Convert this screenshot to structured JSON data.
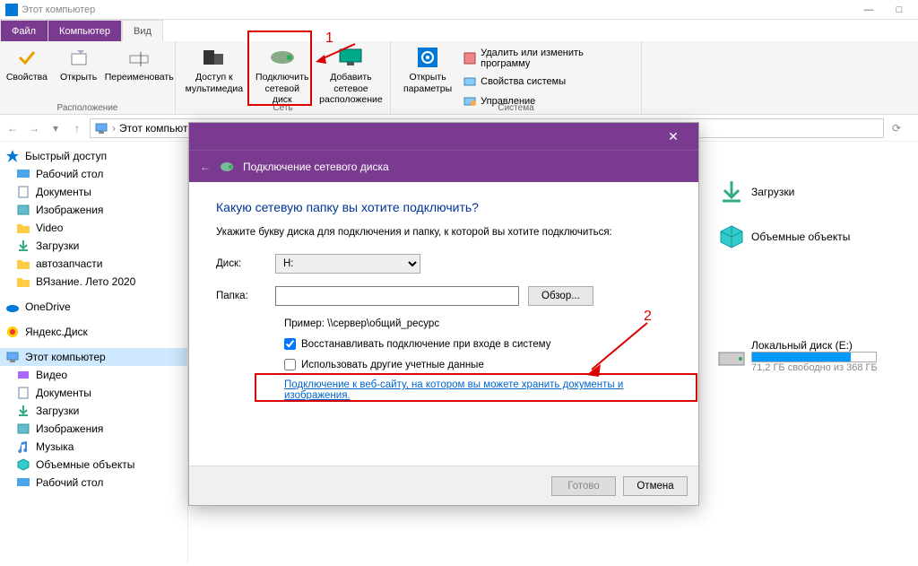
{
  "window": {
    "title": "Этот компьютер"
  },
  "tabs": {
    "file": "Файл",
    "computer": "Компьютер",
    "view": "Вид"
  },
  "ribbon": {
    "group_location": "Расположение",
    "group_network": "Сеть",
    "group_system": "Система",
    "properties": "Свойства",
    "open": "Открыть",
    "rename": "Переименовать",
    "media_access": "Доступ к\nмультимедиа",
    "map_drive": "Подключить\nсетевой диск",
    "add_location": "Добавить сетевое\nрасположение",
    "open_settings": "Открыть\nпараметры",
    "uninstall": "Удалить или изменить программу",
    "sys_props": "Свойства системы",
    "manage": "Управление"
  },
  "breadcrumb": {
    "root": "Этот компьютер"
  },
  "nav": {
    "quick_access": "Быстрый доступ",
    "desktop": "Рабочий стол",
    "documents": "Документы",
    "pictures": "Изображения",
    "video": "Video",
    "downloads": "Загрузки",
    "autopart": "автозапчасти",
    "knitting": "ВЯзание. Лето 2020",
    "onedrive": "OneDrive",
    "yadisk": "Яндекс.Диск",
    "this_pc": "Этот компьютер",
    "video2": "Видео",
    "documents2": "Документы",
    "downloads2": "Загрузки",
    "pictures2": "Изображения",
    "music": "Музыка",
    "objects3d": "Объемные объекты",
    "desktop2": "Рабочий стол"
  },
  "main": {
    "downloads": "Загрузки",
    "objects3d": "Объемные объекты",
    "local_disk_e": "Локальный диск (E:)",
    "disk_free": "71,2 ГБ свободно из 368 ГБ"
  },
  "dialog": {
    "title": "Подключение сетевого диска",
    "heading": "Какую сетевую папку вы хотите подключить?",
    "instructions": "Укажите букву диска для подключения и папку, к которой вы хотите подключиться:",
    "drive_label": "Диск:",
    "drive_value": "H:",
    "folder_label": "Папка:",
    "browse": "Обзор...",
    "example": "Пример: \\\\сервер\\общий_ресурс",
    "reconnect": "Восстанавливать подключение при входе в систему",
    "other_creds": "Использовать другие учетные данные",
    "link": "Подключение к веб-сайту, на котором вы можете хранить документы и изображения",
    "ok": "Готово",
    "cancel": "Отмена"
  },
  "annotations": {
    "one": "1",
    "two": "2"
  }
}
